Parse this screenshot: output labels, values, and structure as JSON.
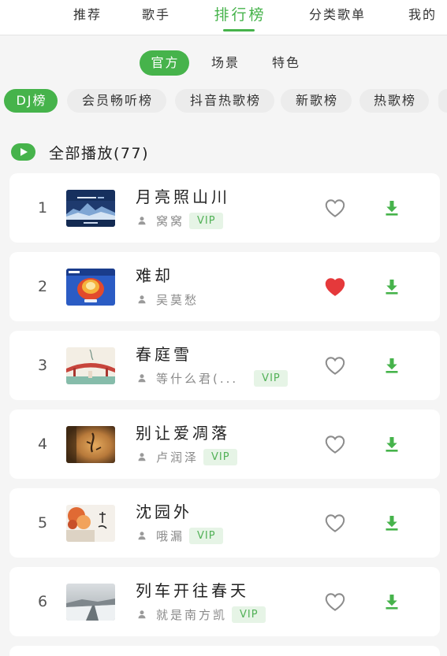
{
  "nav": {
    "tabs": [
      {
        "label": "推荐",
        "active": false
      },
      {
        "label": "歌手",
        "active": false
      },
      {
        "label": "排行榜",
        "active": true
      },
      {
        "label": "分类歌单",
        "active": false
      },
      {
        "label": "我的",
        "active": false
      }
    ]
  },
  "type_pills": [
    {
      "label": "官方",
      "active": true
    },
    {
      "label": "场景",
      "active": false
    },
    {
      "label": "特色",
      "active": false
    }
  ],
  "chart_chips": [
    {
      "label": "DJ榜",
      "active": true
    },
    {
      "label": "会员畅听榜",
      "active": false
    },
    {
      "label": "抖音热歌榜",
      "active": false
    },
    {
      "label": "新歌榜",
      "active": false
    },
    {
      "label": "热歌榜",
      "active": false
    }
  ],
  "play_all": {
    "label": "全部播放(77)"
  },
  "songs": [
    {
      "rank": "1",
      "title": "月亮照山川",
      "artist": "窝窝",
      "vip": "VIP",
      "liked": false
    },
    {
      "rank": "2",
      "title": "难却",
      "artist": "吴莫愁",
      "vip": "",
      "liked": true
    },
    {
      "rank": "3",
      "title": "春庭雪",
      "artist": "等什么君(...",
      "vip": "VIP",
      "liked": false
    },
    {
      "rank": "4",
      "title": "别让爱凋落",
      "artist": "卢润泽",
      "vip": "VIP",
      "liked": false
    },
    {
      "rank": "5",
      "title": "沈园外",
      "artist": "哦漏",
      "vip": "VIP",
      "liked": false
    },
    {
      "rank": "6",
      "title": "列车开往春天",
      "artist": "就是南方凯",
      "vip": "VIP",
      "liked": false
    }
  ],
  "icons": {
    "play_all": "play-icon",
    "artist": "person-icon",
    "like": "heart-icon",
    "download": "download-icon"
  },
  "colors": {
    "accent": "#46b34b",
    "liked": "#e5393b",
    "vip_bg": "#e6f4e6",
    "vip_text": "#52b157",
    "page_bg": "#f5f5f5",
    "card_bg": "#ffffff"
  }
}
